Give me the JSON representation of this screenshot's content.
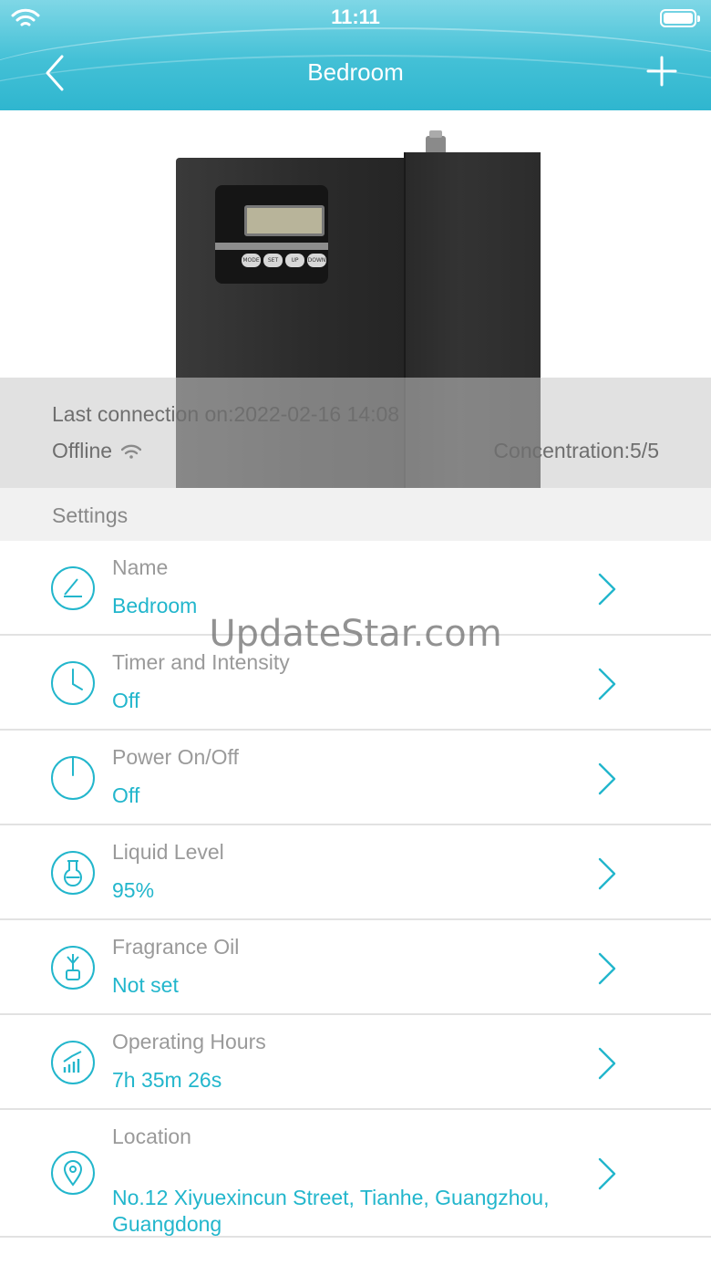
{
  "status_bar": {
    "time": "11:11",
    "wifi_icon": "wifi-icon",
    "battery_icon": "battery-icon"
  },
  "nav": {
    "title": "Bedroom",
    "back_icon": "chevron-left-icon",
    "add_icon": "plus-icon"
  },
  "device": {
    "image_icon": "diffuser-device-image",
    "keys": [
      "MODE",
      "SET",
      "UP",
      "DOWN"
    ],
    "last_connection": "Last connection on:2022-02-16 14:08",
    "status": "Offline",
    "concentration": "Concentration:5/5"
  },
  "settings": {
    "header": "Settings",
    "items": [
      {
        "label": "Name",
        "value": "Bedroom",
        "icon": "edit-icon"
      },
      {
        "label": "Timer and Intensity",
        "value": "Off",
        "icon": "clock-icon"
      },
      {
        "label": "Power On/Off",
        "value": "Off",
        "icon": "power-icon"
      },
      {
        "label": "Liquid Level",
        "value": "95%",
        "icon": "flask-icon"
      },
      {
        "label": "Fragrance Oil",
        "value": "Not set",
        "icon": "fragrance-bottle-icon"
      },
      {
        "label": "Operating Hours",
        "value": "7h 35m 26s",
        "icon": "chart-icon"
      },
      {
        "label": "Location",
        "value": "No.12 Xiyuexincun Street, Tianhe, Guangzhou, Guangdong",
        "icon": "location-pin-icon"
      }
    ]
  },
  "watermark": "UpdateStar.com",
  "colors": {
    "accent": "#22b6cc",
    "header": "#43c0d6",
    "label": "#9a9a9a"
  }
}
